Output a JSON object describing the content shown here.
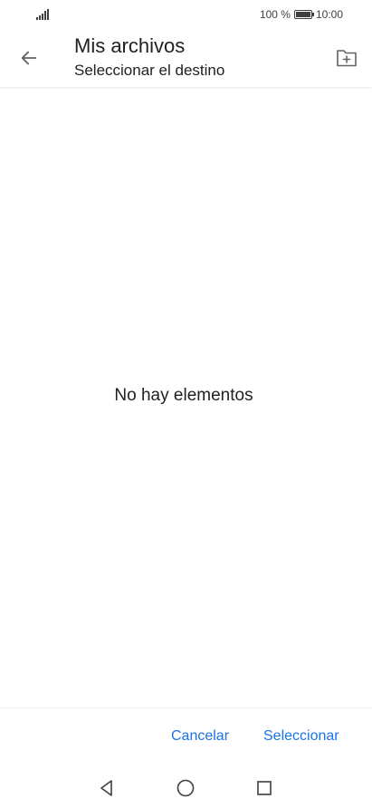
{
  "status": {
    "battery_percent": "100 %",
    "battery_level": 1.0,
    "time": "10:00"
  },
  "header": {
    "title": "Mis archivos",
    "subtitle": "Seleccionar el destino",
    "back_icon": "arrow-left-icon",
    "action_icon": "new-folder-icon"
  },
  "main": {
    "empty_message": "No hay elementos"
  },
  "footer": {
    "cancel_label": "Cancelar",
    "select_label": "Seleccionar",
    "accent_color": "#1a73e8"
  },
  "nav": {
    "back_icon": "nav-back-triangle-icon",
    "home_icon": "nav-home-circle-icon",
    "recent_icon": "nav-recent-square-icon"
  }
}
